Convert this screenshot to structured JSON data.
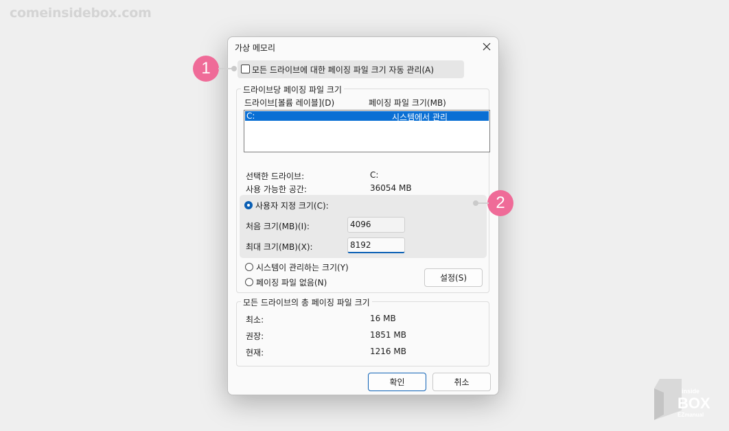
{
  "watermark": "comeinsidebox.com",
  "dialog": {
    "title": "가상 메모리",
    "auto_manage_label": "모든 드라이브에 대한 페이징 파일 크기 자동 관리(A)",
    "per_drive": {
      "legend": "드라이브당 페이징 파일 크기",
      "col_drive": "드라이브[볼륨 레이블](D)",
      "col_size": "페이징 파일 크기(MB)",
      "rows": [
        {
          "drive": "C:",
          "size": "시스템에서 관리"
        }
      ],
      "selected_drive_label": "선택한 드라이브:",
      "selected_drive_value": "C:",
      "free_space_label": "사용 가능한 공간:",
      "free_space_value": "36054 MB",
      "custom_size_label": "사용자 지정 크기(C):",
      "initial_size_label": "처음 크기(MB)(I):",
      "initial_size_value": "4096",
      "max_size_label": "최대 크기(MB)(X):",
      "max_size_value": "8192",
      "system_managed_label": "시스템이 관리하는 크기(Y)",
      "no_paging_label": "페이징 파일 없음(N)",
      "set_button": "설정(S)"
    },
    "total": {
      "legend": "모든 드라이브의 총 페이징 파일 크기",
      "min_label": "최소:",
      "min_value": "16 MB",
      "recommended_label": "권장:",
      "recommended_value": "1851 MB",
      "current_label": "현재:",
      "current_value": "1216 MB"
    },
    "ok_button": "확인",
    "cancel_button": "취소"
  },
  "badges": {
    "one": "1",
    "two": "2"
  },
  "logo": {
    "line1": "inside",
    "line2": "BOX",
    "line3": "EZmanual"
  },
  "colors": {
    "accent": "#0a6fd4",
    "badge": "#ef6b98"
  }
}
